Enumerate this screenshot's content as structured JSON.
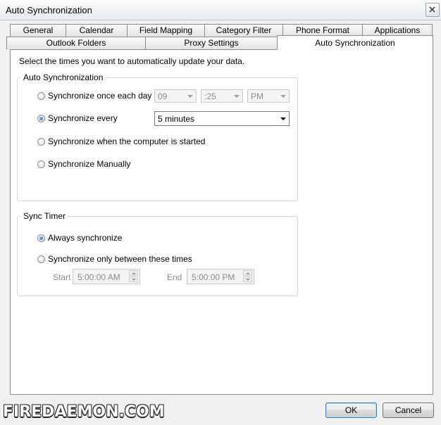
{
  "window": {
    "title": "Auto Synchronization"
  },
  "tabs_row1": [
    "General",
    "Calendar",
    "Field Mapping",
    "Category Filter",
    "Phone Format",
    "Applications"
  ],
  "tabs_row2": [
    "Outlook Folders",
    "Proxy Settings",
    "Auto Synchronization"
  ],
  "instruction": "Select the times you want to automatically update your data.",
  "auto_sync": {
    "label": "Auto Synchronization",
    "opt_daily": "Synchronize once each day at",
    "hour": "09",
    "minute": ":25",
    "ampm": "PM",
    "opt_every": "Synchronize every",
    "interval": "5 minutes",
    "opt_startup": "Synchronize when the computer is started",
    "opt_manual": "Synchronize Manually"
  },
  "sync_timer": {
    "label": "Sync Timer",
    "opt_always": "Always synchronize",
    "opt_between": "Synchronize only between these times",
    "start_label": "Start",
    "start_value": "5:00:00 AM",
    "end_label": "End",
    "end_value": "5:00:00 PM"
  },
  "buttons": {
    "ok": "OK",
    "cancel": "Cancel"
  },
  "watermark": "FIREDAEMON.COM"
}
